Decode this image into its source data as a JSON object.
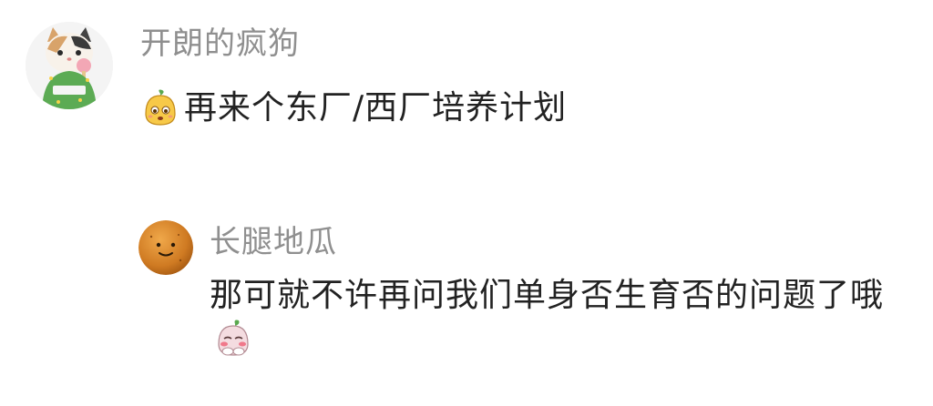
{
  "comments": [
    {
      "username": "开朗的疯狗",
      "avatar_icon": "cat-avatar-icon",
      "lead_emoji": "yellow-blob-emoji-icon",
      "text": "再来个东厂/西厂培养计划"
    }
  ],
  "reply": {
    "username": "长腿地瓜",
    "avatar_icon": "potato-avatar-icon",
    "text": "那可就不许再问我们单身否生育否的问题了哦",
    "trail_emoji": "shy-blushing-emoji-icon"
  },
  "colors": {
    "username": "#8f8f8f",
    "text": "#222222",
    "background": "#ffffff"
  }
}
